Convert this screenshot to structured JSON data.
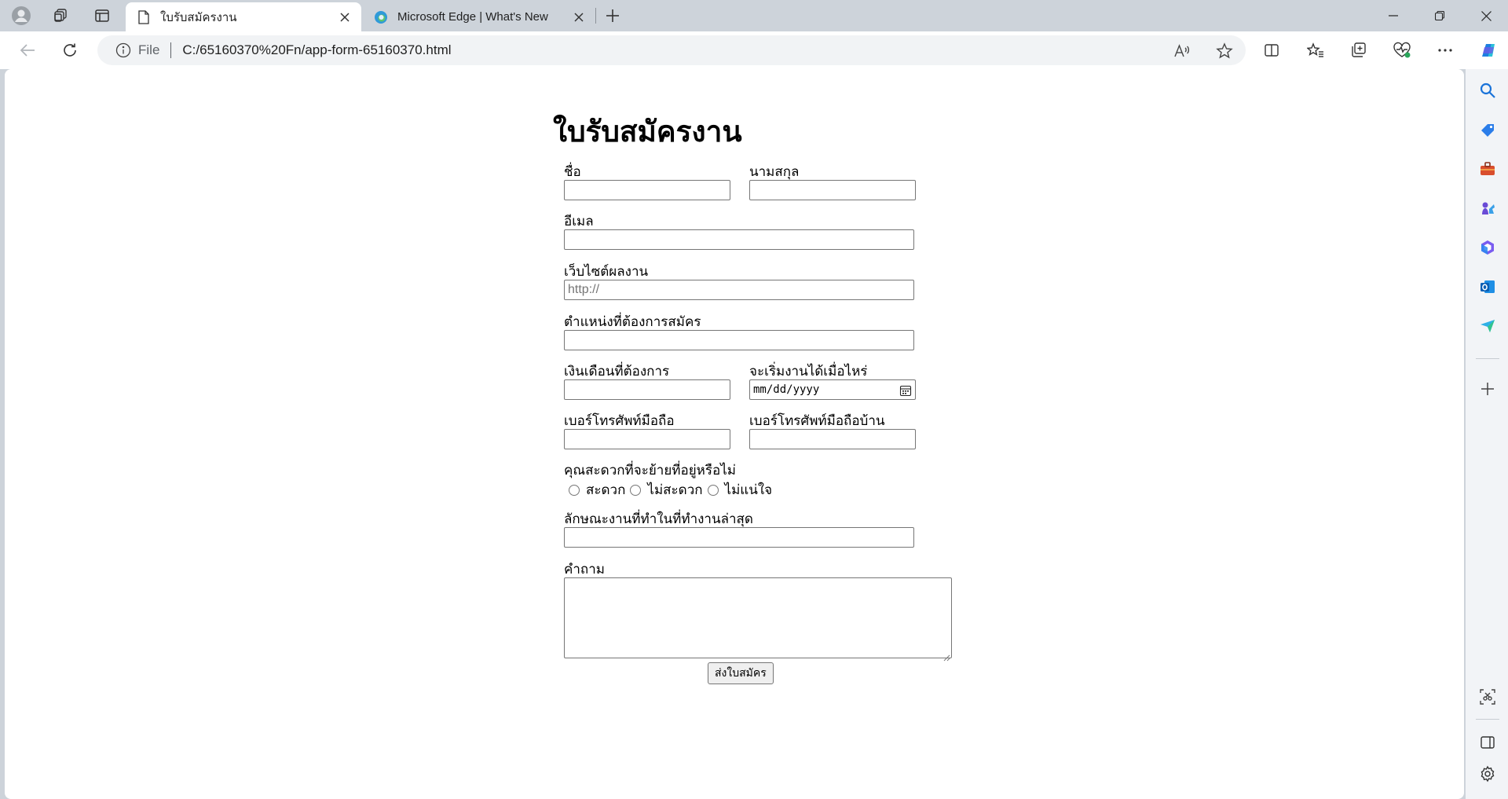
{
  "browser": {
    "tabs": [
      {
        "title": "ใบรับสมัครงาน",
        "active": true
      },
      {
        "title": "Microsoft Edge | What's New",
        "active": false
      }
    ],
    "address": {
      "scheme": "File",
      "url": "C:/65160370%20Fn/app-form-65160370.html"
    },
    "icons": {
      "profile": "profile-avatar-icon",
      "workspaces": "workspaces-icon",
      "tab_actions": "vertical-tabs-icon",
      "page": "document-icon",
      "edge": "edge-logo-icon",
      "read_aloud": "read-aloud-icon",
      "favorite": "star-icon",
      "split": "split-screen-icon",
      "favorites": "favorites-icon",
      "collections": "collections-icon",
      "health": "browser-essentials-icon",
      "more": "more-icon",
      "copilot": "copilot-icon"
    },
    "sidebar": [
      "search-icon",
      "shopping-tag-icon",
      "tools-briefcase-icon",
      "games-icon",
      "microsoft365-icon",
      "outlook-icon",
      "drop-send-icon",
      "add-icon",
      "screenshot-icon",
      "sidebar-panel-icon",
      "settings-icon"
    ],
    "colors": {
      "accent": "#0f6cbd",
      "chrome": "#cdd3da",
      "sidebar": "#f2f4f7"
    }
  },
  "form": {
    "title": "ใบรับสมัครงาน",
    "first_name_label": "ชื่อ",
    "last_name_label": "นามสกุล",
    "email_label": "อีเมล",
    "website_label": "เว็บไซต์ผลงาน",
    "website_placeholder": "http://",
    "position_label": "ตำแหน่งที่ต้องการสมัคร",
    "salary_label": "เงินเดือนที่ต้องการ",
    "start_date_label": "จะเริ่มงานได้เมื่อไหร่",
    "start_date_placeholder": "mm/dd/yyyy",
    "mobile_label": "เบอร์โทรศัพท์มือถือ",
    "home_phone_label": "เบอร์โทรศัพท์มือถือบ้าน",
    "relocate_label": "คุณสะดวกที่จะย้ายที่อยู่หรือไม่",
    "relocate_options": [
      "สะดวก",
      "ไม่สะดวก",
      "ไม่แน่ใจ"
    ],
    "last_job_label": "ลักษณะงานที่ทำในที่ทำงานล่าสุด",
    "question_label": "คำถาม",
    "submit_label": "ส่งใบสมัคร"
  }
}
